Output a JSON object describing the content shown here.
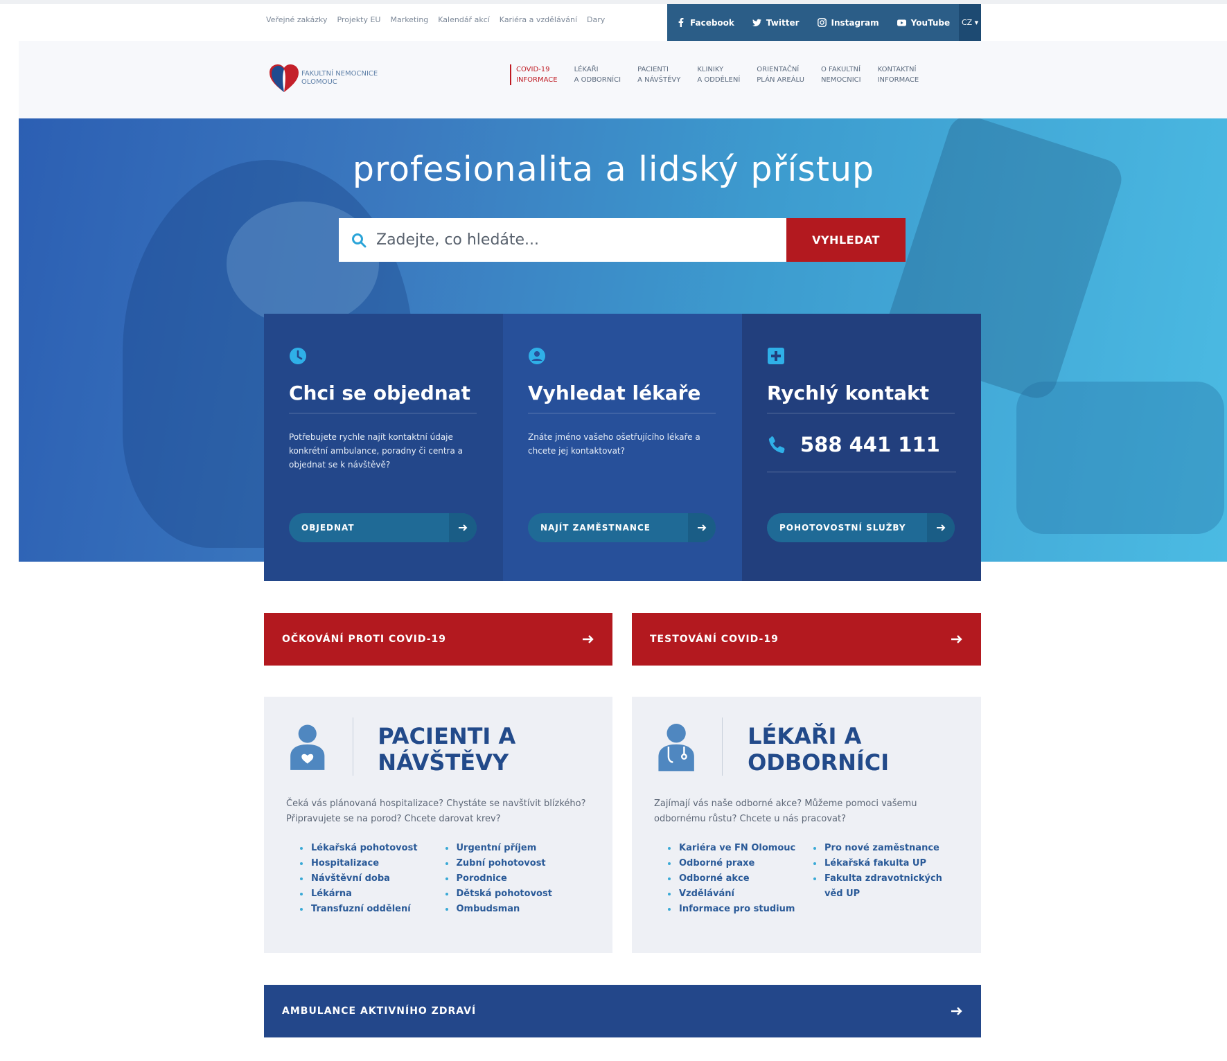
{
  "utility_links": [
    "Veřejné zakázky",
    "Projekty EU",
    "Marketing",
    "Kalendář akcí",
    "Kariéra a vzdělávání",
    "Dary"
  ],
  "social": {
    "facebook": "Facebook",
    "twitter": "Twitter",
    "instagram": "Instagram",
    "youtube": "YouTube",
    "lang": "CZ ▾"
  },
  "logo": {
    "line1": "FAKULTNÍ NEMOCNICE",
    "line2": "OLOMOUC"
  },
  "nav": [
    {
      "l1": "COVID-19",
      "l2": "INFORMACE"
    },
    {
      "l1": "LÉKAŘI",
      "l2": "A ODBORNÍCI"
    },
    {
      "l1": "PACIENTI",
      "l2": "A NÁVŠTĚVY"
    },
    {
      "l1": "KLINIKY",
      "l2": "A ODDĚLENÍ"
    },
    {
      "l1": "ORIENTAČNÍ",
      "l2": "PLÁN AREÁLU"
    },
    {
      "l1": "O FAKULTNÍ",
      "l2": "NEMOCNICI"
    },
    {
      "l1": "KONTAKTNÍ",
      "l2": "INFORMACE"
    }
  ],
  "hero": {
    "title": "profesionalita a lidský přístup",
    "search_placeholder": "Zadejte, co hledáte...",
    "search_button": "VYHLEDAT"
  },
  "boxes": [
    {
      "title": "Chci se objednat",
      "text": "Potřebujete rychle najít kontaktní údaje konkrétní ambulance, poradny či centra a objednat se k návštěvě?",
      "button": "OBJEDNAT"
    },
    {
      "title": "Vyhledat lékaře",
      "text": "Znáte jméno vašeho ošetřujícího lékaře a chcete jej kontaktovat?",
      "button": "NAJÍT ZAMĚSTNANCE"
    },
    {
      "title": "Rychlý kontakt",
      "phone": "588 441 111",
      "button": "POHOTOVOSTNÍ SLUŽBY"
    }
  ],
  "covid": {
    "vaccination": "OČKOVÁNÍ PROTI COVID-19",
    "testing": "TESTOVÁNÍ COVID-19"
  },
  "patients": {
    "title": "PACIENTI A NÁVŠTĚVY",
    "desc": "Čeká vás plánovaná hospitalizace? Chystáte se navštívit blízkého? Připravujete se na porod? Chcete darovat krev?",
    "col1": [
      "Lékařská pohotovost",
      "Hospitalizace",
      "Návštěvní doba",
      "Lékárna",
      "Transfuzní oddělení"
    ],
    "col2": [
      "Urgentní příjem",
      "Zubní pohotovost",
      "Porodnice",
      "Dětská pohotovost",
      "Ombudsman"
    ]
  },
  "doctors": {
    "title": "LÉKAŘI A ODBORNÍCI",
    "desc": "Zajímají vás naše odborné akce? Můžeme pomoci vašemu odbornému růstu? Chcete u nás pracovat?",
    "col1": [
      "Kariéra ve FN Olomouc",
      "Odborné praxe",
      "Odborné akce",
      "Vzdělávání",
      "Informace pro studium"
    ],
    "col2": [
      "Pro nové zaměstnance",
      "Lékařská fakulta UP",
      "Fakulta zdravotnických věd UP"
    ]
  },
  "ambulance": "AMBULANCE AKTIVNÍHO ZDRAVÍ",
  "colors": {
    "accent_red": "#b3191f",
    "brand_blue": "#23478a",
    "teal": "#1f6a96"
  }
}
